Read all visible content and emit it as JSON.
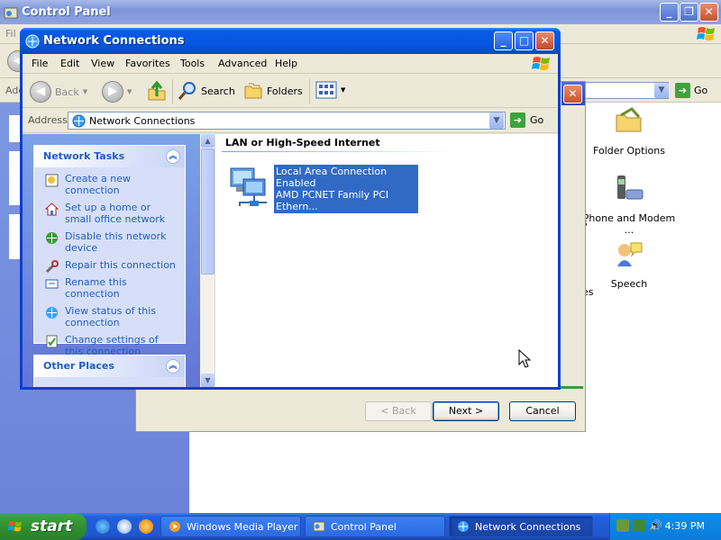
{
  "control_panel": {
    "title": "Control Panel",
    "menu_stub": "Fil",
    "address_stub": "Add",
    "go_label": "Go",
    "items": [
      {
        "label": "Folder Options"
      },
      {
        "label": "Phone and Modem ..."
      },
      {
        "label": "Speech"
      }
    ],
    "glimpse": [
      "s",
      "es"
    ]
  },
  "wizard": {
    "back_label": "< Back",
    "next_label": "Next >",
    "cancel_label": "Cancel"
  },
  "network_connections": {
    "title": "Network Connections",
    "menu": [
      "File",
      "Edit",
      "View",
      "Favorites",
      "Tools",
      "Advanced",
      "Help"
    ],
    "toolbar": {
      "back_label": "Back",
      "search_label": "Search",
      "folders_label": "Folders"
    },
    "address": {
      "label": "Address",
      "value": "Network Connections",
      "go_label": "Go"
    },
    "network_tasks": {
      "title": "Network Tasks",
      "items": [
        {
          "label": "Create a new connection",
          "icon": "new-connection-icon"
        },
        {
          "label": "Set up a home or small office network",
          "icon": "home-network-icon"
        },
        {
          "label": "Disable this network device",
          "icon": "disable-device-icon"
        },
        {
          "label": "Repair this connection",
          "icon": "repair-icon"
        },
        {
          "label": "Rename this connection",
          "icon": "rename-icon"
        },
        {
          "label": "View status of this connection",
          "icon": "status-icon"
        },
        {
          "label": "Change settings of this connection",
          "icon": "settings-icon"
        }
      ]
    },
    "other_places": {
      "title": "Other Places"
    },
    "group_header": "LAN or High-Speed Internet",
    "connection": {
      "name": "Local Area Connection",
      "status": "Enabled",
      "device": "AMD PCNET Family PCI Ethern..."
    }
  },
  "taskbar": {
    "start_label": "start",
    "buttons": [
      "Windows Media Player",
      "Control Panel",
      "Network Connections"
    ],
    "clock": "4:39 PM"
  },
  "colors": {
    "xp_blue": "#0556e0",
    "task_link": "#215dc6",
    "selection": "#316ac5",
    "start_green": "#2f8f2f"
  }
}
